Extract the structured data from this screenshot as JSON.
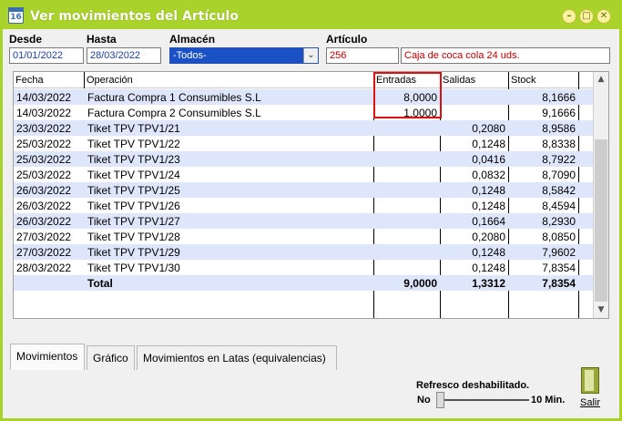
{
  "window": {
    "title": "Ver movimientos del Artículo",
    "icon_text": "16",
    "controls": [
      "minimize-icon",
      "maximize-icon",
      "close-icon"
    ]
  },
  "filters": {
    "desde_label": "Desde",
    "desde_value": "01/01/2022",
    "hasta_label": "Hasta",
    "hasta_value": "28/03/2022",
    "almacen_label": "Almacén",
    "almacen_value": "-Todos-",
    "articulo_label": "Artículo",
    "articulo_code": "256",
    "articulo_name": "Caja de coca cola 24 uds."
  },
  "table": {
    "columns": [
      "Fecha",
      "Operación",
      "Entradas",
      "Salidas",
      "Stock"
    ],
    "rows": [
      {
        "fecha": "14/03/2022",
        "operacion": "Factura Compra 1 Consumibles S.L",
        "entradas": "8,0000",
        "salidas": "",
        "stock": "8,1666"
      },
      {
        "fecha": "14/03/2022",
        "operacion": "Factura Compra 2 Consumibles S.L",
        "entradas": "1,0000",
        "salidas": "",
        "stock": "9,1666"
      },
      {
        "fecha": "23/03/2022",
        "operacion": "Tiket TPV TPV1/21",
        "entradas": "",
        "salidas": "0,2080",
        "stock": "8,9586"
      },
      {
        "fecha": "25/03/2022",
        "operacion": "Tiket TPV TPV1/22",
        "entradas": "",
        "salidas": "0,1248",
        "stock": "8,8338"
      },
      {
        "fecha": "25/03/2022",
        "operacion": "Tiket TPV TPV1/23",
        "entradas": "",
        "salidas": "0,0416",
        "stock": "8,7922"
      },
      {
        "fecha": "25/03/2022",
        "operacion": "Tiket TPV TPV1/24",
        "entradas": "",
        "salidas": "0,0832",
        "stock": "8,7090"
      },
      {
        "fecha": "26/03/2022",
        "operacion": "Tiket TPV TPV1/25",
        "entradas": "",
        "salidas": "0,1248",
        "stock": "8,5842"
      },
      {
        "fecha": "26/03/2022",
        "operacion": "Tiket TPV TPV1/26",
        "entradas": "",
        "salidas": "0,1248",
        "stock": "8,4594"
      },
      {
        "fecha": "26/03/2022",
        "operacion": "Tiket TPV TPV1/27",
        "entradas": "",
        "salidas": "0,1664",
        "stock": "8,2930"
      },
      {
        "fecha": "27/03/2022",
        "operacion": "Tiket TPV TPV1/28",
        "entradas": "",
        "salidas": "0,2080",
        "stock": "8,0850"
      },
      {
        "fecha": "27/03/2022",
        "operacion": "Tiket TPV TPV1/29",
        "entradas": "",
        "salidas": "0,1248",
        "stock": "7,9602"
      },
      {
        "fecha": "28/03/2022",
        "operacion": "Tiket TPV TPV1/30",
        "entradas": "",
        "salidas": "0,1248",
        "stock": "7,8354"
      }
    ],
    "total": {
      "label": "Total",
      "entradas": "9,0000",
      "salidas": "1,3312",
      "stock": "7,8354"
    }
  },
  "tabs": [
    "Movimientos",
    "Gráfico",
    "Movimientos en Latas (equivalencias)"
  ],
  "active_tab": "Movimientos",
  "refresh": {
    "label": "Refresco deshabilitado.",
    "min_label": "No",
    "max_label": "10 Min.",
    "level_fraction": 0
  },
  "exit_label": "Salir",
  "colors": {
    "title_bar": "#a9d22a",
    "row_alt": "#dde6fb",
    "select_bg": "#1a52c5",
    "highlight": "#e01010"
  }
}
